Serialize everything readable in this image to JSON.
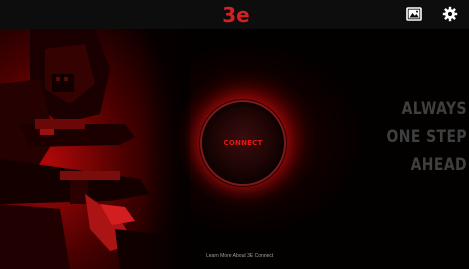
{
  "app": {
    "logo_text": "3e",
    "brand_color": "#d42020"
  },
  "topbar": {
    "icons": [
      "gallery-icon",
      "settings-icon"
    ]
  },
  "main": {
    "connect_label": "CONNECT",
    "tagline": [
      "ALWAYS",
      "ONE STEP",
      "AHEAD"
    ],
    "learn_more": "Learn More About 3E Connect"
  },
  "colors": {
    "background": "#050000",
    "topbar": "#0d0d0d",
    "accent": "#e01818",
    "tagline": "#3f3f3f"
  }
}
